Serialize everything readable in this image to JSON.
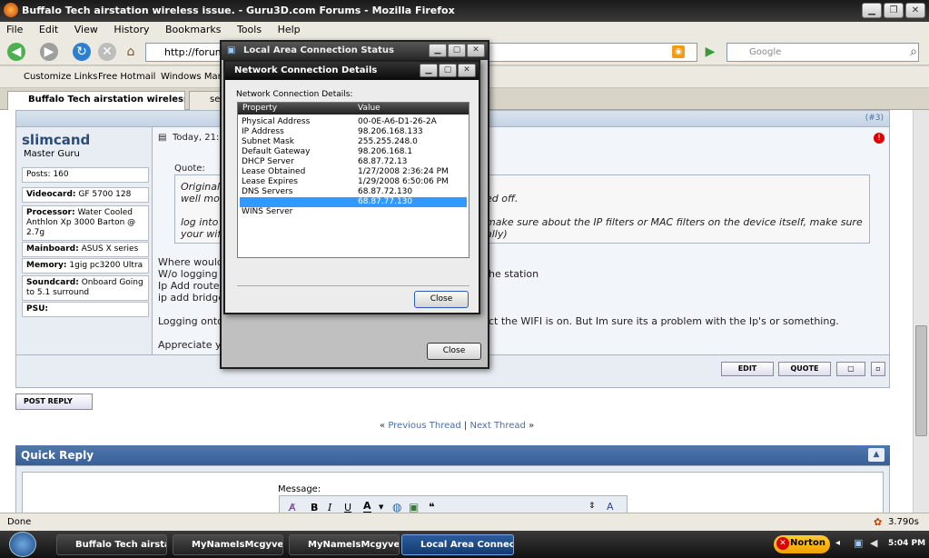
{
  "window": {
    "title": "Buffalo Tech airstation wireless issue. - Guru3D.com Forums - Mozilla Firefox",
    "min": "▁",
    "max": "❐",
    "close": "✕"
  },
  "menu": [
    "File",
    "Edit",
    "View",
    "History",
    "Bookmarks",
    "Tools",
    "Help"
  ],
  "nav": {
    "url": "http://forums.g",
    "search_placeholder": "Google"
  },
  "bookmarks": [
    "Customize Links",
    "Free Hotmail",
    "Windows Market"
  ],
  "tabs": [
    "Buffalo Tech airstation wireless i...",
    "set"
  ],
  "post": {
    "number": "(#3)",
    "username": "slimcand",
    "usertitle": "Master Guru",
    "stats": [
      {
        "label": "Posts:",
        "value": "160"
      },
      {
        "label": "Videocard:",
        "value": "GF 5700 128"
      },
      {
        "label": "Processor:",
        "value": "Water Cooled Anthlon Xp 3000 Barton @ 2.7g"
      },
      {
        "label": "Mainboard:",
        "value": "ASUS X series"
      },
      {
        "label": "Memory:",
        "value": "1gig pc3200 Ultra"
      },
      {
        "label": "Soundcard:",
        "value": "Onboard Going to 5.1 surround"
      },
      {
        "label": "PSU:",
        "value": ""
      }
    ],
    "date": "Today, 21:5",
    "quote_label": "Quote:",
    "quote_lines": [
      "Originall",
      "well mos",
      "ed off.",
      "log into",
      "make sure about the IP filters or MAC filters on the device itself, make sure",
      "your wifi",
      "ally)"
    ],
    "body_lines": [
      "Where would",
      "W/o logging",
      "he station",
      "Ip Add route",
      "ip add bridge",
      "Logging onto",
      "ct the WIFI is on. But Im sure its a problem with the Ip's or something.",
      "Appreciate y"
    ],
    "buttons": {
      "edit": "EDIT",
      "quote": "QUOTE"
    }
  },
  "post_reply": "POST REPLY",
  "thread_nav": {
    "prev": "Previous Thread",
    "sep": "|",
    "next": "Next Thread"
  },
  "quick_reply": {
    "title": "Quick Reply",
    "message_label": "Message:"
  },
  "status": {
    "left": "Done",
    "right": "3.790s"
  },
  "dialog_status": {
    "title": "Local Area Connection Status",
    "close": "Close"
  },
  "dialog_details": {
    "title": "Network Connection Details",
    "label": "Network Connection Details:",
    "columns": [
      "Property",
      "Value"
    ],
    "rows": [
      {
        "p": "Physical Address",
        "v": "00-0E-A6-D1-26-2A"
      },
      {
        "p": "IP Address",
        "v": "98.206.168.133"
      },
      {
        "p": "Subnet Mask",
        "v": "255.255.248.0"
      },
      {
        "p": "Default Gateway",
        "v": "98.206.168.1"
      },
      {
        "p": "DHCP Server",
        "v": "68.87.72.13"
      },
      {
        "p": "Lease Obtained",
        "v": "1/27/2008 2:36:24 PM"
      },
      {
        "p": "Lease Expires",
        "v": "1/29/2008 6:50:06 PM"
      },
      {
        "p": "DNS Servers",
        "v": "68.87.72.130"
      },
      {
        "p": "",
        "v": "68.87.77.130"
      },
      {
        "p": "WINS Server",
        "v": ""
      }
    ],
    "close": "Close"
  },
  "taskbar": {
    "items": [
      "Buffalo Tech airsta...",
      "MyNameIsMcgyver...",
      "MyNameIsMcgyver...",
      "Local Area Connec..."
    ],
    "norton": "Norton",
    "clock": "5:04 PM"
  },
  "colors": {
    "accent": "#3399ff",
    "forum_blue": "#385f96"
  }
}
